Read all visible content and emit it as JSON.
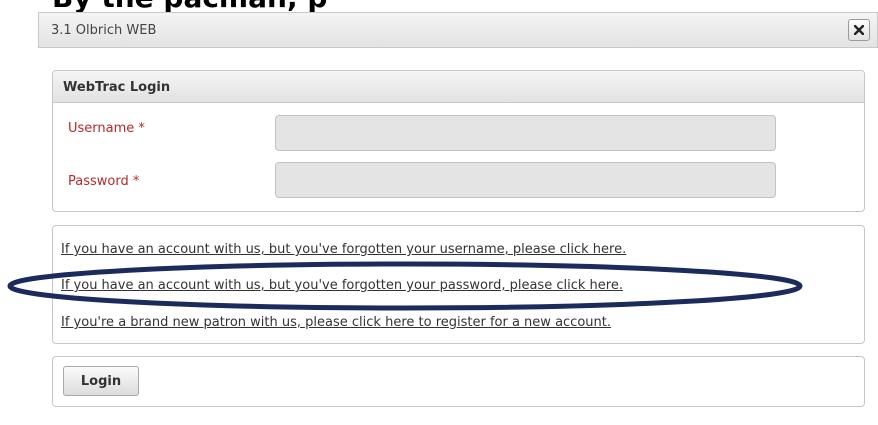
{
  "top_banner": "By the pacman, p",
  "dialog": {
    "title": "3.1 Olbrich WEB",
    "close_icon": "close-icon"
  },
  "login_panel": {
    "heading": "WebTrac Login",
    "username_label": "Username *",
    "username_value": "",
    "password_label": "Password *",
    "password_value": ""
  },
  "links": [
    "If you have an account with us, but you've forgotten your username, please click here.",
    "If you have an account with us, but you've forgotten your password, please click here.",
    "If you're a brand new patron with us, please click here to register for a new account."
  ],
  "actions": {
    "login_label": "Login"
  },
  "colors": {
    "required_label": "#b52a2a",
    "highlight_ellipse": "#1a2b5c"
  }
}
